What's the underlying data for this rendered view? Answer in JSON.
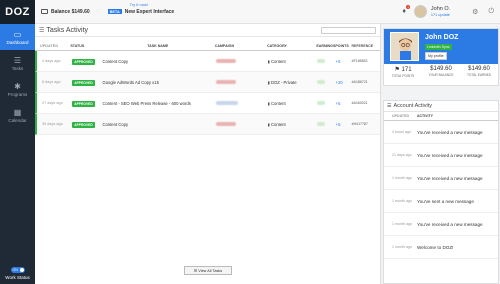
{
  "brand": "DOZ",
  "sidebar": {
    "items": [
      {
        "label": "Dashboard",
        "icon": "monitor-icon",
        "active": true
      },
      {
        "label": "Tasks",
        "icon": "list-icon"
      },
      {
        "label": "Programs",
        "icon": "gear-icon"
      },
      {
        "label": "Calendar",
        "icon": "calendar-icon"
      }
    ],
    "work_status": "Work Status",
    "toggle_label": "ON"
  },
  "topbar": {
    "balance": "Balance $149.60",
    "try_now": "Try it now!",
    "beta_badge": "BETA",
    "beta_text": "New Expert Interface",
    "notif_count": "1",
    "user_name": "John O.",
    "user_update": "171 update"
  },
  "tasks": {
    "title": "Tasks Activity",
    "columns": [
      "UPDATED",
      "STATUS",
      "TASK NAME",
      "CAMPAIGN",
      "CATEGORY",
      "EARNINGS",
      "POINTS",
      "REFERENCE"
    ],
    "rows": [
      {
        "updated": "4 days ago",
        "status": "APPROVED",
        "name": "Content Copy",
        "category": "Content",
        "points": "+5",
        "reference": "#F165833"
      },
      {
        "updated": "6 days ago",
        "status": "APPROVED",
        "name": "Google AdWords Ad Copy x15",
        "category": "DOZ - Private",
        "points": "+20",
        "reference": "#A186721"
      },
      {
        "updated": "27 days ago",
        "status": "APPROVED",
        "name": "Content - SEO Web Press Release - 600 words",
        "category": "Content",
        "points": "+5",
        "reference": "#A160021"
      },
      {
        "updated": "39 days ago",
        "status": "APPROVED",
        "name": "Content Copy",
        "category": "Content",
        "points": "+5",
        "reference": "#H417787"
      }
    ],
    "view_all": "View All Tasks"
  },
  "profile": {
    "name": "John DOZ",
    "linkedin_btn": "LinkedIn Sync",
    "myprofile_btn": "My profile",
    "stats": [
      {
        "value": "171",
        "label": "TOTAL POINTS"
      },
      {
        "value": "$149.60",
        "label": "YOUR BALANCE"
      },
      {
        "value": "$149.60",
        "label": "TOTAL EARNED"
      }
    ]
  },
  "activity": {
    "title": "Account Activity",
    "columns": [
      "UPDATED",
      "ACTIVITY"
    ],
    "rows": [
      {
        "time": "4 hours ago",
        "msg": "You've received a new message"
      },
      {
        "time": "21 days ago",
        "msg": "You've received a new message"
      },
      {
        "time": "1 month ago",
        "msg": "You've received a new message"
      },
      {
        "time": "1 month ago",
        "msg": "You've sent a new message"
      },
      {
        "time": "1 month ago",
        "msg": "You've received a new message"
      },
      {
        "time": "1 month ago",
        "msg": "Welcome to DOZ!"
      }
    ]
  },
  "colors": {
    "accent": "#2c7be5",
    "approved": "#2fb344",
    "sidebar": "#1f2a36"
  }
}
